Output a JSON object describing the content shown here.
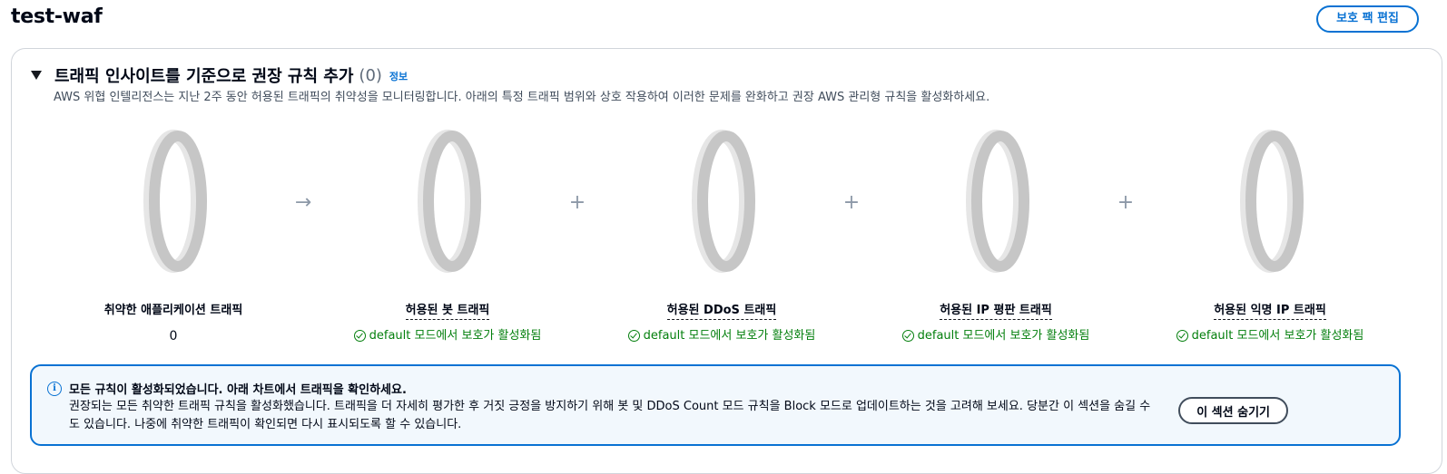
{
  "page": {
    "title": "test-waf",
    "edit_button": "보호 팩 편집"
  },
  "section": {
    "title": "트래픽 인사이트를 기준으로 권장 규칙 추가",
    "count": "(0)",
    "info_link": "정보",
    "description": "AWS 위협 인텔리전스는 지난 2주 동안 허용된 트래픽의 취약성을 모니터링합니다. 아래의 특정 트래픽 범위와 상호 작용하여 이러한 문제를 완화하고 권장 AWS 관리형 규칙을 활성화하세요."
  },
  "metrics": [
    {
      "label": "취약한 애플리케이션 트래픽",
      "value": "0"
    },
    {
      "label": "허용된 봇 트래픽",
      "status": "default 모드에서 보호가 활성화됨"
    },
    {
      "label": "허용된 DDoS 트래픽",
      "status": "default 모드에서 보호가 활성화됨"
    },
    {
      "label": "허용된 IP 평판 트래픽",
      "status": "default 모드에서 보호가 활성화됨"
    },
    {
      "label": "허용된 익명 IP 트래픽",
      "status": "default 모드에서 보호가 활성화됨"
    }
  ],
  "operators": [
    "→",
    "+",
    "+",
    "+"
  ],
  "alert": {
    "title": "모든 규칙이 활성화되었습니다. 아래 차트에서 트래픽을 확인하세요.",
    "body": "권장되는 모든 취약한 트래픽 규칙을 활성화했습니다. 트래픽을 더 자세히 평가한 후 거짓 긍정을 방지하기 위해 봇 및 DDoS Count 모드 규칙을 Block 모드로 업데이트하는 것을 고려해 보세요. 당분간 이 섹션을 숨길 수도 있습니다. 나중에 취약한 트래픽이 확인되면 다시 표시되도록 할 수 있습니다.",
    "hide_button": "이 섹션 숨기기"
  },
  "colors": {
    "accent": "#0972d3",
    "success": "#037f0c",
    "ring": "#c6c6c6"
  }
}
